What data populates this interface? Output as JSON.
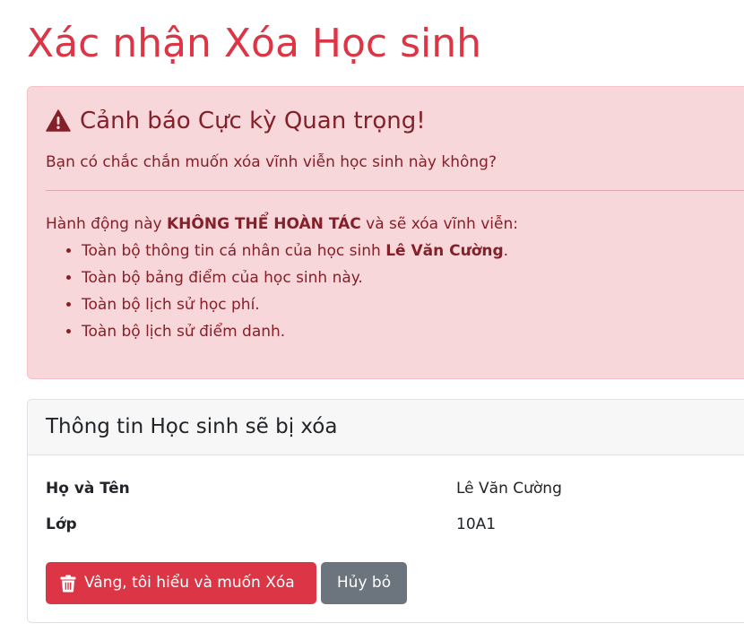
{
  "page": {
    "title": "Xác nhận Xóa Học sinh"
  },
  "alert": {
    "heading": "Cảnh báo Cực kỳ Quan trọng!",
    "icon": "warning-triangle-icon",
    "question": "Bạn có chắc chắn muốn xóa vĩnh viễn học sinh này không?",
    "lead_prefix": "Hành động này ",
    "lead_bold": "KHÔNG THỂ HOÀN TÁC",
    "lead_suffix": " và sẽ xóa vĩnh viễn:",
    "items": [
      {
        "prefix": "Toàn bộ thông tin cá nhân của học sinh ",
        "bold": "Lê Văn Cường",
        "suffix": "."
      },
      {
        "text": "Toàn bộ bảng điểm của học sinh này."
      },
      {
        "text": "Toàn bộ lịch sử học phí."
      },
      {
        "text": "Toàn bộ lịch sử điểm danh."
      }
    ]
  },
  "card": {
    "title": "Thông tin Học sinh sẽ bị xóa",
    "fields": [
      {
        "label": "Họ và Tên",
        "value": "Lê Văn Cường"
      },
      {
        "label": "Lớp",
        "value": "10A1"
      }
    ],
    "confirm_label": "Vâng, tôi hiểu và muốn Xóa",
    "confirm_icon": "trash-icon",
    "cancel_label": "Hủy bỏ"
  },
  "colors": {
    "danger": "#dc3545",
    "alert_bg": "#f8d7da",
    "alert_text": "#842029",
    "secondary": "#6c757d"
  }
}
